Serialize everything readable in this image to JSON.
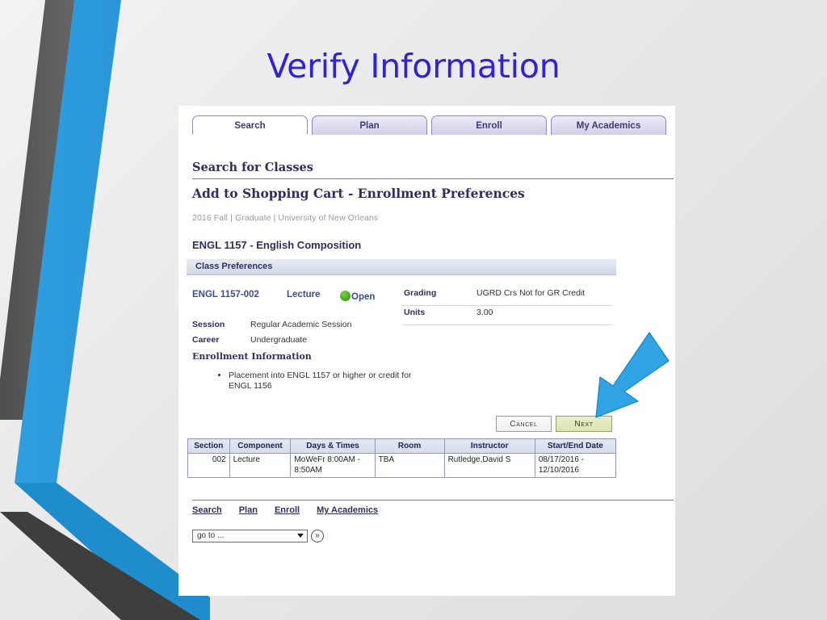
{
  "slide": {
    "title": "Verify Information",
    "title_color": "#3022d8",
    "accent_blue": "#2fa3e3",
    "accent_gray": "#5a5a5a",
    "background": "#e9e9e9"
  },
  "browser": {
    "tabs": [
      {
        "label": "Search",
        "active": true
      },
      {
        "label": "Plan",
        "active": false
      },
      {
        "label": "Enroll",
        "active": false
      },
      {
        "label": "My Academics",
        "active": false
      }
    ],
    "page_heading": "Search for Classes",
    "sub_heading": "Add to Shopping Cart - Enrollment Preferences",
    "breadcrumb": "2016 Fall | Graduate | University of New Orleans",
    "course_title": "ENGL 1157 - English Composition",
    "preferences": {
      "section_bar_label": "Class Preferences",
      "class_code": "ENGL 1157-002",
      "component": "Lecture",
      "status_label": "Open",
      "status_color": "#4caf22",
      "details": [
        {
          "key": "Session",
          "value": "Regular Academic Session"
        },
        {
          "key": "Career",
          "value": "Undergraduate"
        }
      ],
      "enrollment_info_heading": "Enrollment Information",
      "enrollment_info_items": [
        "Placement into ENGL 1157 or higher or credit for ENGL 1156"
      ],
      "right_details": [
        {
          "key": "Grading",
          "value": "UGRD Crs Not for GR Credit"
        },
        {
          "key": "Units",
          "value": "3.00"
        }
      ]
    },
    "buttons": {
      "cancel": "Cancel",
      "next": "Next",
      "next_bg": "#e4eabd"
    },
    "schedule_table": {
      "columns": [
        "Section",
        "Component",
        "Days & Times",
        "Room",
        "Instructor",
        "Start/End Date"
      ],
      "rows": [
        {
          "section": "002",
          "component": "Lecture",
          "days_times": "MoWeFr 8:00AM - 8:50AM",
          "room": "TBA",
          "instructor": "Rutledge,David S",
          "start_end_date": "08/17/2016 - 12/10/2016"
        }
      ]
    },
    "footer_links": [
      "Search",
      "Plan",
      "Enroll",
      "My Academics"
    ],
    "goto": {
      "selected": "go to ...",
      "go_label": "»"
    }
  },
  "annotation": {
    "arrow_color": "#2fa3e3",
    "points_to": "Next"
  }
}
